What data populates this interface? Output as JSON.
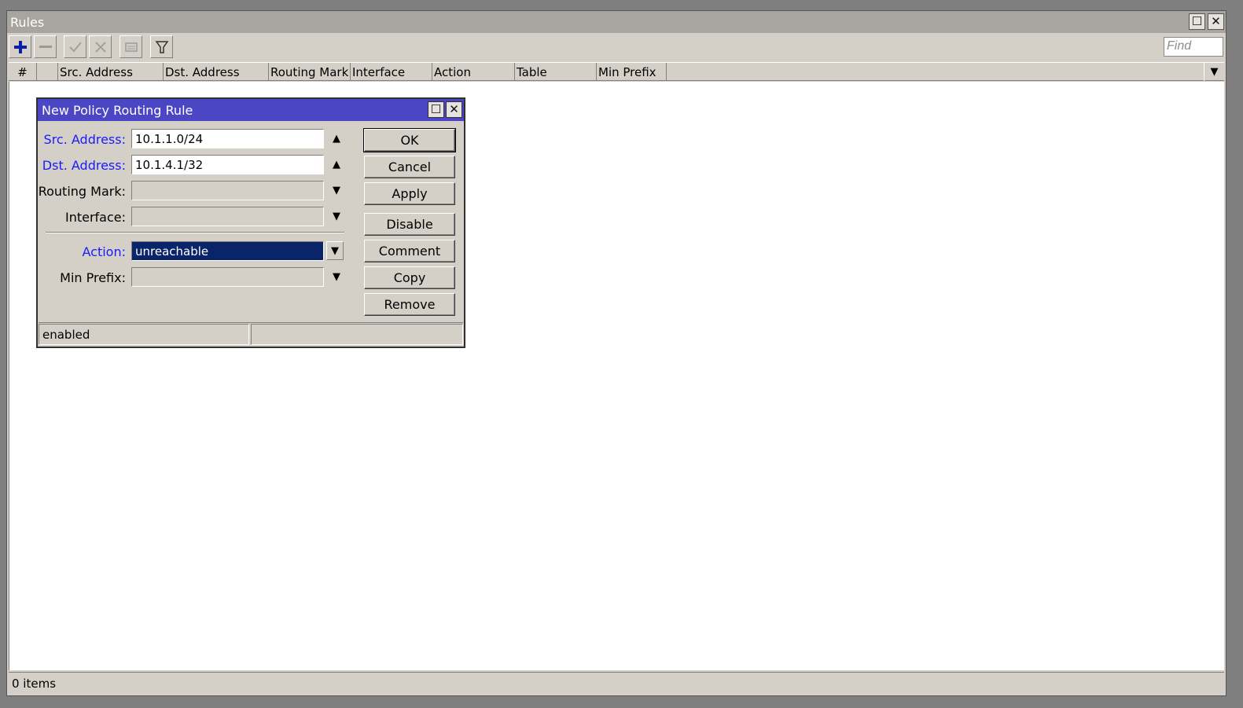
{
  "window": {
    "title": "Rules",
    "maximize_icon": "maximize-icon",
    "close_icon": "close-icon"
  },
  "toolbar": {
    "find_placeholder": "Find",
    "buttons": [
      "add-icon",
      "remove-icon",
      "enable-icon",
      "disable-icon",
      "comment-icon",
      "filter-icon"
    ]
  },
  "table": {
    "columns": [
      "#",
      "",
      "Src. Address",
      "Dst. Address",
      "Routing Mark",
      "Interface",
      "Action",
      "Table",
      "Min Prefix"
    ]
  },
  "status": {
    "items_count": "0 items"
  },
  "dialog": {
    "title": "New Policy Routing Rule",
    "fields": {
      "src_address": {
        "label": "Src. Address:",
        "value": "10.1.1.0/24"
      },
      "dst_address": {
        "label": "Dst. Address:",
        "value": "10.1.4.1/32"
      },
      "routing_mark": {
        "label": "Routing Mark:",
        "value": ""
      },
      "interface": {
        "label": "Interface:",
        "value": ""
      },
      "action": {
        "label": "Action:",
        "value": "unreachable"
      },
      "min_prefix": {
        "label": "Min Prefix:",
        "value": ""
      }
    },
    "buttons": {
      "ok": "OK",
      "cancel": "Cancel",
      "apply": "Apply",
      "disable": "Disable",
      "comment": "Comment",
      "copy": "Copy",
      "remove": "Remove"
    },
    "status_left": "enabled",
    "status_right": ""
  },
  "colors": {
    "dialog_title_bg": "#4a46c4",
    "label_highlight": "#1a1aff",
    "selection_bg": "#0a246a"
  }
}
